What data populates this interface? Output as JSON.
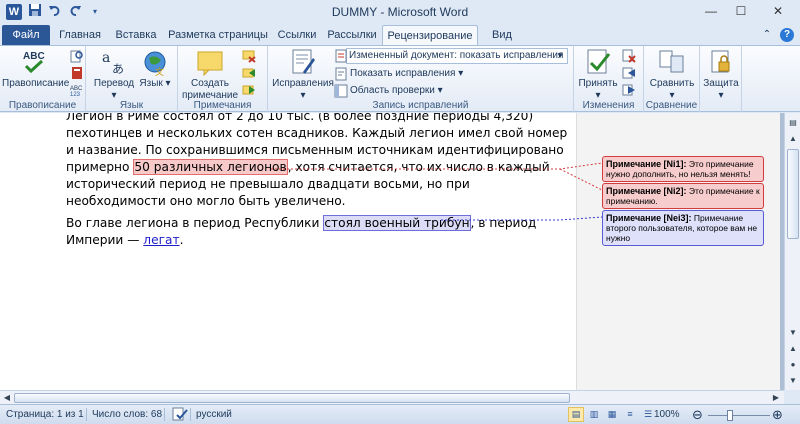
{
  "window": {
    "title": "DUMMY  -  Microsoft Word",
    "app_icon": "W",
    "qat": [
      "save-icon",
      "undo-icon",
      "redo-icon",
      "customize-icon"
    ]
  },
  "tabs": [
    {
      "label": "Файл",
      "key": "file"
    },
    {
      "label": "Главная",
      "key": "home"
    },
    {
      "label": "Вставка",
      "key": "insert"
    },
    {
      "label": "Разметка страницы",
      "key": "layout"
    },
    {
      "label": "Ссылки",
      "key": "references"
    },
    {
      "label": "Рассылки",
      "key": "mailings"
    },
    {
      "label": "Рецензирование",
      "key": "review",
      "active": true
    },
    {
      "label": "Вид",
      "key": "view"
    }
  ],
  "ribbon": {
    "proofing": {
      "label": "Правописание",
      "spelling": "Правописание",
      "abc_text": "ABC"
    },
    "language": {
      "label": "Язык",
      "translate": "Перевод",
      "lang": "Язык"
    },
    "comments": {
      "label": "Примечания",
      "new_comment_line1": "Создать",
      "new_comment_line2": "примечание"
    },
    "tracking": {
      "label": "Запись исправлений",
      "track_changes": "Исправления",
      "display_for_review": "Измененный документ: показать исправления",
      "show_markup": "Показать исправления",
      "reviewing_pane": "Область проверки"
    },
    "changes": {
      "label": "Изменения",
      "accept": "Принять"
    },
    "compare": {
      "label": "Сравнение",
      "compare": "Сравнить"
    },
    "protect": {
      "label": "",
      "protect": "Защита"
    }
  },
  "document": {
    "p1": {
      "line0": "Легион в Риме состоял от 2 до 10 тыс. (в более поздние периоды 4,320)",
      "line1": "пехотинцев и нескольких сотен всадников. Каждый легион имел свой номер и",
      "line2": "название. По сохранившимся письменным источникам идентифицировано",
      "pre": "примерно ",
      "highlight": "50 различных легионов",
      "post": ", хотя считается, что их число в каждый",
      "line4": "исторический период не превышало двадцати восьми, но при необходимости оно",
      "line5": "могло быть увеличено."
    },
    "p2": {
      "pre": "Во главе легиона в период Республики ",
      "highlight": "стоял военный трибун",
      "post": ", в период",
      "line2_pre": "Империи — ",
      "inserted": "легат",
      "end": "."
    }
  },
  "comments": [
    {
      "id": "[Ni1]",
      "label": "Примечание",
      "text": "Это примечание нужно дополнить, но нельзя менять!",
      "color": "#f7cccc"
    },
    {
      "id": "[Ni2]",
      "label": "Примечание",
      "text": "Это примечание к примечанию.",
      "color": "#f7cccc"
    },
    {
      "id": "[Nei3]",
      "label": "Примечание",
      "text": "Примечание второго пользователя, которое вам не нужно",
      "color": "#dfe0fa"
    }
  ],
  "status": {
    "page": "Страница: 1 из 1",
    "words": "Число слов: 68",
    "language": "русский",
    "zoom": "100%"
  },
  "colors": {
    "accent": "#2b579a",
    "comment_red_border": "#d23c3c",
    "comment_blue_border": "#5a5ad2"
  }
}
